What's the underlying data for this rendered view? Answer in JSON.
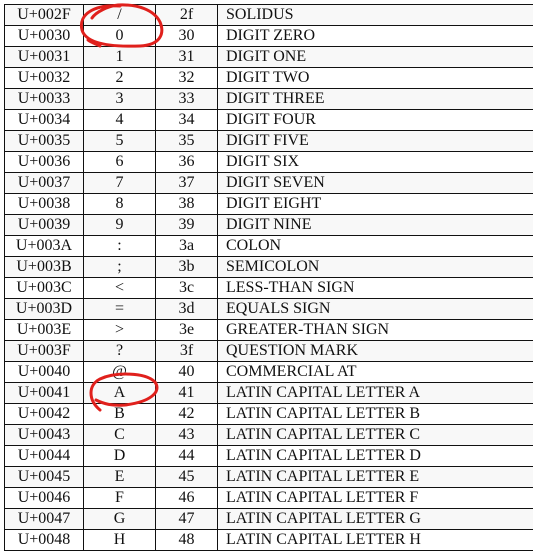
{
  "annotation_color": "#e0201c",
  "rows": [
    {
      "code": "U+002F",
      "char": "/",
      "hex": "2f",
      "name": "SOLIDUS"
    },
    {
      "code": "U+0030",
      "char": "0",
      "hex": "30",
      "name": "DIGIT ZERO"
    },
    {
      "code": "U+0031",
      "char": "1",
      "hex": "31",
      "name": "DIGIT ONE"
    },
    {
      "code": "U+0032",
      "char": "2",
      "hex": "32",
      "name": "DIGIT TWO"
    },
    {
      "code": "U+0033",
      "char": "3",
      "hex": "33",
      "name": "DIGIT THREE"
    },
    {
      "code": "U+0034",
      "char": "4",
      "hex": "34",
      "name": "DIGIT FOUR"
    },
    {
      "code": "U+0035",
      "char": "5",
      "hex": "35",
      "name": "DIGIT FIVE"
    },
    {
      "code": "U+0036",
      "char": "6",
      "hex": "36",
      "name": "DIGIT SIX"
    },
    {
      "code": "U+0037",
      "char": "7",
      "hex": "37",
      "name": "DIGIT SEVEN"
    },
    {
      "code": "U+0038",
      "char": "8",
      "hex": "38",
      "name": "DIGIT EIGHT"
    },
    {
      "code": "U+0039",
      "char": "9",
      "hex": "39",
      "name": "DIGIT NINE"
    },
    {
      "code": "U+003A",
      "char": ":",
      "hex": "3a",
      "name": "COLON"
    },
    {
      "code": "U+003B",
      "char": ";",
      "hex": "3b",
      "name": "SEMICOLON"
    },
    {
      "code": "U+003C",
      "char": "<",
      "hex": "3c",
      "name": "LESS-THAN SIGN"
    },
    {
      "code": "U+003D",
      "char": "=",
      "hex": "3d",
      "name": "EQUALS SIGN"
    },
    {
      "code": "U+003E",
      "char": ">",
      "hex": "3e",
      "name": "GREATER-THAN SIGN"
    },
    {
      "code": "U+003F",
      "char": "?",
      "hex": "3f",
      "name": "QUESTION MARK"
    },
    {
      "code": "U+0040",
      "char": "@",
      "hex": "40",
      "name": "COMMERCIAL AT"
    },
    {
      "code": "U+0041",
      "char": "A",
      "hex": "41",
      "name": "LATIN CAPITAL LETTER A"
    },
    {
      "code": "U+0042",
      "char": "B",
      "hex": "42",
      "name": "LATIN CAPITAL LETTER B"
    },
    {
      "code": "U+0043",
      "char": "C",
      "hex": "43",
      "name": "LATIN CAPITAL LETTER C"
    },
    {
      "code": "U+0044",
      "char": "D",
      "hex": "44",
      "name": "LATIN CAPITAL LETTER D"
    },
    {
      "code": "U+0045",
      "char": "E",
      "hex": "45",
      "name": "LATIN CAPITAL LETTER E"
    },
    {
      "code": "U+0046",
      "char": "F",
      "hex": "46",
      "name": "LATIN CAPITAL LETTER F"
    },
    {
      "code": "U+0047",
      "char": "G",
      "hex": "47",
      "name": "LATIN CAPITAL LETTER G"
    },
    {
      "code": "U+0048",
      "char": "H",
      "hex": "48",
      "name": "LATIN CAPITAL LETTER H"
    }
  ]
}
